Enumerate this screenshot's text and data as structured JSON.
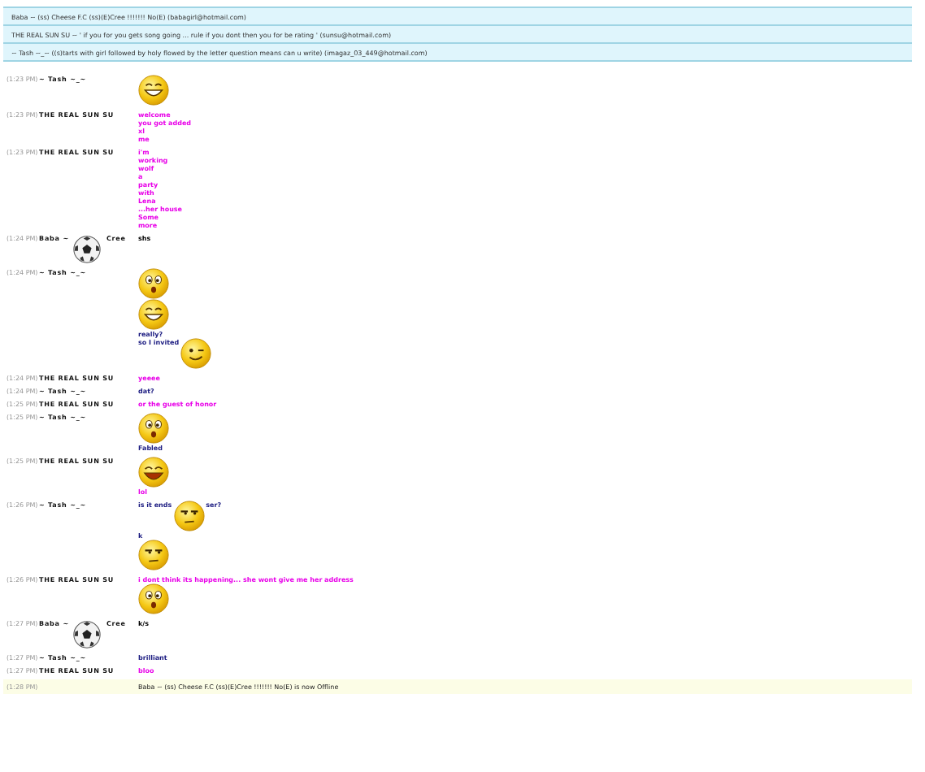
{
  "contacts": [
    {
      "text": "Baba ~ (ss) Cheese F.C (ss)(E)Cree !!!!!!! No(E) (babagirl@hotmail.com)"
    },
    {
      "text": "THE REAL SUN SU ~ ' if you for you gets song going ... rule if you dont then you for be rating ' (sunsu@hotmail.com)"
    },
    {
      "text": "~ Tash ~_~ ((s)tarts with girl followed by holy flowed by the letter question means can u write) (imagaz_03_449@hotmail.com)"
    }
  ],
  "messages": [
    {
      "time": "(1:23 PM)",
      "sender": [
        {
          "kind": "text",
          "text": "~ Tash ~_~"
        }
      ],
      "body": [
        {
          "kind": "grin"
        }
      ]
    },
    {
      "time": "(1:23 PM)",
      "sender": [
        {
          "kind": "text",
          "text": "THE REAL SUN SU"
        }
      ],
      "color": "#e800e8",
      "body": [
        {
          "kind": "text",
          "text": "welcome"
        },
        {
          "kind": "text",
          "text": "you got added"
        },
        {
          "kind": "text",
          "text": "xl"
        },
        {
          "kind": "text",
          "text": "me"
        }
      ]
    },
    {
      "time": "(1:23 PM)",
      "sender": [
        {
          "kind": "text",
          "text": "THE REAL SUN SU"
        }
      ],
      "color": "#e800e8",
      "body": [
        {
          "kind": "text",
          "text": "i'm"
        },
        {
          "kind": "text",
          "text": "working"
        },
        {
          "kind": "text",
          "text": "wolf"
        },
        {
          "kind": "text",
          "text": "a"
        },
        {
          "kind": "text",
          "text": "party"
        },
        {
          "kind": "text",
          "text": "with"
        },
        {
          "kind": "text",
          "text": "Lena"
        },
        {
          "kind": "text",
          "text": "...her house"
        },
        {
          "kind": "text",
          "text": "Some"
        },
        {
          "kind": "text",
          "text": "more"
        }
      ]
    },
    {
      "time": "(1:24 PM)",
      "sender": [
        {
          "kind": "text",
          "text": "Baba ~"
        },
        {
          "kind": "ball"
        },
        {
          "kind": "text",
          "text": "Cree"
        }
      ],
      "color": "#000000",
      "body": [
        {
          "kind": "text",
          "text": "shs"
        }
      ]
    },
    {
      "time": "(1:24 PM)",
      "sender": [
        {
          "kind": "text",
          "text": "~ Tash ~_~"
        }
      ],
      "color": "#1a1a80",
      "body": [
        {
          "kind": "surprised"
        },
        {
          "kind": "grin"
        },
        {
          "kind": "text",
          "text": "really?"
        },
        {
          "kind": "inline",
          "items": [
            {
              "kind": "text",
              "text": "so I invited"
            },
            {
              "kind": "wink"
            }
          ]
        }
      ]
    },
    {
      "time": "(1:24 PM)",
      "sender": [
        {
          "kind": "text",
          "text": "THE REAL SUN SU"
        }
      ],
      "color": "#e800e8",
      "body": [
        {
          "kind": "text",
          "text": "yeeee"
        }
      ]
    },
    {
      "time": "(1:24 PM)",
      "sender": [
        {
          "kind": "text",
          "text": "~ Tash ~_~"
        }
      ],
      "color": "#1a1a80",
      "body": [
        {
          "kind": "text",
          "text": "dat?"
        }
      ]
    },
    {
      "time": "(1:25 PM)",
      "sender": [
        {
          "kind": "text",
          "text": "THE REAL SUN SU"
        }
      ],
      "color": "#e800e8",
      "body": [
        {
          "kind": "text",
          "text": "or the guest of honor"
        }
      ]
    },
    {
      "time": "(1:25 PM)",
      "sender": [
        {
          "kind": "text",
          "text": "~ Tash ~_~"
        }
      ],
      "color": "#1a1a80",
      "body": [
        {
          "kind": "surprised"
        },
        {
          "kind": "text",
          "text": "Fabled"
        }
      ]
    },
    {
      "time": "(1:25 PM)",
      "sender": [
        {
          "kind": "text",
          "text": "THE REAL SUN SU"
        }
      ],
      "color": "#e800e8",
      "body": [
        {
          "kind": "laugh"
        },
        {
          "kind": "text",
          "text": "lol"
        }
      ]
    },
    {
      "time": "(1:26 PM)",
      "sender": [
        {
          "kind": "text",
          "text": "~ Tash ~_~"
        }
      ],
      "color": "#1a1a80",
      "body": [
        {
          "kind": "inline",
          "items": [
            {
              "kind": "text",
              "text": "is it ends"
            },
            {
              "kind": "annoyed"
            },
            {
              "kind": "text",
              "text": "ser?"
            }
          ]
        },
        {
          "kind": "text",
          "text": "k"
        },
        {
          "kind": "annoyed"
        }
      ]
    },
    {
      "time": "(1:26 PM)",
      "sender": [
        {
          "kind": "text",
          "text": "THE REAL SUN SU"
        }
      ],
      "color": "#e800e8",
      "body": [
        {
          "kind": "text",
          "text": "i dont think its happening... she wont give me her address"
        },
        {
          "kind": "surprised"
        }
      ]
    },
    {
      "time": "(1:27 PM)",
      "sender": [
        {
          "kind": "text",
          "text": "Baba ~"
        },
        {
          "kind": "ball"
        },
        {
          "kind": "text",
          "text": "Cree"
        }
      ],
      "color": "#000000",
      "body": [
        {
          "kind": "text",
          "text": "k/s"
        }
      ]
    },
    {
      "time": "(1:27 PM)",
      "sender": [
        {
          "kind": "text",
          "text": "~ Tash ~_~"
        }
      ],
      "color": "#1a1a80",
      "body": [
        {
          "kind": "text",
          "text": "brilliant"
        }
      ]
    },
    {
      "time": "(1:27 PM)",
      "sender": [
        {
          "kind": "text",
          "text": "THE REAL SUN SU"
        }
      ],
      "color": "#e800e8",
      "body": [
        {
          "kind": "text",
          "text": "bloo"
        }
      ]
    }
  ],
  "status": {
    "time": "(1:28 PM)",
    "text": "Baba ~ (ss) Cheese F.C (ss)(E)Cree !!!!!!! No(E) is now Offline"
  }
}
